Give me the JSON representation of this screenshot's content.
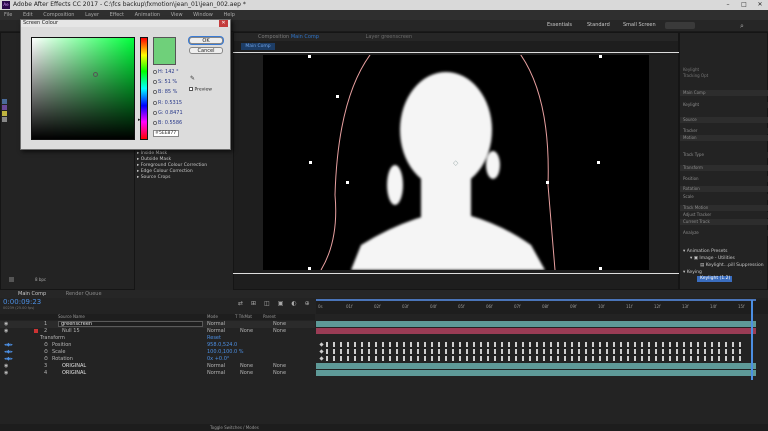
{
  "titlebar": {
    "title": "Adobe After Effects CC 2017 - C:\\fcs backup\\fxmotion\\jean_01\\jean_002.aep *",
    "logo": "Ae",
    "minimize": "–",
    "maximize": "□",
    "close": "✕"
  },
  "menubar": {
    "items": [
      "File",
      "Edit",
      "Composition",
      "Layer",
      "Effect",
      "Animation",
      "View",
      "Window",
      "Help"
    ]
  },
  "workspaces": [
    "Essentials",
    "Standard",
    "Small Screen"
  ],
  "viewer_tabs": {
    "composition": "Composition",
    "comp_name": "Main Comp",
    "layer": "Layer greenscreen",
    "breadcrumb": "Main Comp"
  },
  "dialog": {
    "title": "Screen Colour",
    "ok": "OK",
    "cancel": "Cancel",
    "preview": "Preview",
    "fields": [
      {
        "label": "H:",
        "value": "142 °"
      },
      {
        "label": "S:",
        "value": "51 %"
      },
      {
        "label": "B:",
        "value": "85 %"
      },
      {
        "label": "R:",
        "value": "0.5315"
      },
      {
        "label": "G:",
        "value": "0.8471"
      },
      {
        "label": "B:",
        "value": "0.5586"
      }
    ],
    "hex": "5EE877",
    "swatch_color": "#6fd07a"
  },
  "effect_controls": [
    "Screen Matte",
    "Inside Mask",
    "Outside Mask",
    "Foreground Colour Correction",
    "Edge Colour Correction",
    "Source Crops"
  ],
  "project": {
    "bpc": "8 bpc"
  },
  "right_panel": {
    "header": "Keylight",
    "sub": "Tracking Opt",
    "list": [
      "Main Comp",
      "Keylight",
      "Source",
      "Tracker",
      "Motion",
      "Track Type",
      "Transform",
      "Position",
      "Rotation",
      "Scale",
      "Track Motion",
      "Adjust Tracker",
      "Current Track",
      "Analyze",
      "Reset",
      "Apply"
    ],
    "presets_header": "Animation Presets",
    "tree": [
      "Image - Utilities",
      "Keylight...pill Suppression",
      "Keying"
    ],
    "selected": "Keylight (1.2)"
  },
  "timeline": {
    "tab": "Main Comp",
    "tab2": "Render Queue",
    "timecode": "0:00:09:23",
    "fps": "00239 (25.00 fps)",
    "columns": [
      "Source Name",
      "Mode",
      "T TrkMat",
      "Parent"
    ],
    "layers": [
      {
        "num": "1",
        "name": "greenscreen",
        "mode": "Normal",
        "trk": "",
        "parent": "None"
      },
      {
        "num": "2",
        "name": "Null 15",
        "mode": "Normal",
        "trk": "None",
        "parent": "None"
      },
      {
        "num": "",
        "name": "Transform",
        "mode": "Reset",
        "trk": "",
        "parent": ""
      },
      {
        "num": "",
        "name": "Position",
        "mode": "958.0,524.0",
        "trk": "",
        "parent": ""
      },
      {
        "num": "",
        "name": "Scale",
        "mode": "100.0,100.0 %",
        "trk": "",
        "parent": ""
      },
      {
        "num": "",
        "name": "Rotation",
        "mode": "0x +0.0°",
        "trk": "",
        "parent": ""
      },
      {
        "num": "3",
        "name": "ORIGINAL",
        "mode": "Normal",
        "trk": "None",
        "parent": "None"
      },
      {
        "num": "4",
        "name": "ORIGINAL",
        "mode": "Normal",
        "trk": "None",
        "parent": "None"
      }
    ],
    "ruler": [
      "0s",
      "01f",
      "02f",
      "03f",
      "04f",
      "05f",
      "06f",
      "07f",
      "08f",
      "09f",
      "10f",
      "11f",
      "12f",
      "13f",
      "14f",
      "15f"
    ],
    "footer": "Toggle Switches / Modes"
  },
  "colors": {
    "accent": "#2f74c8",
    "pink_bar": "#9a3c55",
    "teal_bar": "#5e9a98",
    "dialog_bg": "#dcdcdc"
  }
}
